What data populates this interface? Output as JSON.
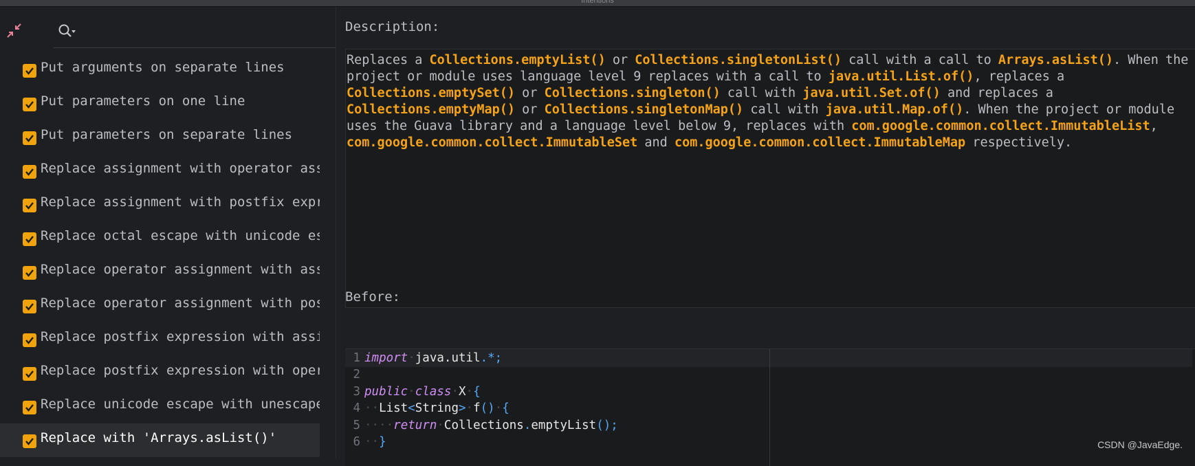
{
  "window": {
    "title": "Intentions"
  },
  "toolbar": {
    "collapse_icon": "collapse-icon",
    "search_icon": "search-icon"
  },
  "intentions": [
    {
      "label": "Put arguments on separate lines",
      "checked": true
    },
    {
      "label": "Put parameters on one line",
      "checked": true
    },
    {
      "label": "Put parameters on separate lines",
      "checked": true
    },
    {
      "label": "Replace assignment with operator assi",
      "checked": true
    },
    {
      "label": "Replace assignment with postfix expre",
      "checked": true
    },
    {
      "label": "Replace octal escape with unicode esc",
      "checked": true
    },
    {
      "label": "Replace operator assignment with assi",
      "checked": true
    },
    {
      "label": "Replace operator assignment with post",
      "checked": true
    },
    {
      "label": "Replace postfix expression with assig",
      "checked": true
    },
    {
      "label": "Replace postfix expression with opera",
      "checked": true
    },
    {
      "label": "Replace unicode escape with unescaped",
      "checked": true
    },
    {
      "label": "Replace with 'Arrays.asList()'",
      "checked": true,
      "selected": true
    }
  ],
  "description": {
    "title": "Description:",
    "segments": [
      {
        "t": "Replaces a ",
        "h": false
      },
      {
        "t": "Collections.emptyList()",
        "h": true
      },
      {
        "t": " or ",
        "h": false
      },
      {
        "t": "Collections.singletonList()",
        "h": true
      },
      {
        "t": " call with a call to ",
        "h": false
      },
      {
        "t": "Arrays.asList()",
        "h": true
      },
      {
        "t": ". When the project or module uses language level 9 replaces with a call to ",
        "h": false
      },
      {
        "t": "java.util.List.of()",
        "h": true
      },
      {
        "t": ", replaces a ",
        "h": false
      },
      {
        "t": "Collections.emptySet()",
        "h": true
      },
      {
        "t": " or ",
        "h": false
      },
      {
        "t": "Collections.singleton()",
        "h": true
      },
      {
        "t": " call with ",
        "h": false
      },
      {
        "t": "java.util.Set.of()",
        "h": true
      },
      {
        "t": " and replaces a ",
        "h": false
      },
      {
        "t": "Collections.emptyMap()",
        "h": true
      },
      {
        "t": " or ",
        "h": false
      },
      {
        "t": "Collections.singletonMap()",
        "h": true
      },
      {
        "t": " call with ",
        "h": false
      },
      {
        "t": "java.util.Map.of()",
        "h": true
      },
      {
        "t": ". When the project or module uses the Guava library and a language level below 9, replaces with ",
        "h": false
      },
      {
        "t": "com.google.common.collect.ImmutableList",
        "h": true
      },
      {
        "t": ", ",
        "h": false
      },
      {
        "t": "com.google.common.collect.ImmutableSet",
        "h": true
      },
      {
        "t": " and ",
        "h": false
      },
      {
        "t": "com.google.common.collect.ImmutableMap",
        "h": true
      },
      {
        "t": " respectively.",
        "h": false
      }
    ]
  },
  "before": {
    "title": "Before:",
    "lines": [
      {
        "n": "1",
        "tokens": [
          {
            "c": "kw",
            "t": "import"
          },
          {
            "c": "ws",
            "t": "·"
          },
          {
            "c": "id",
            "t": "java.util"
          },
          {
            "c": "pn",
            "t": ".*;"
          }
        ]
      },
      {
        "n": "2",
        "tokens": []
      },
      {
        "n": "3",
        "tokens": [
          {
            "c": "kw",
            "t": "public"
          },
          {
            "c": "ws",
            "t": "·"
          },
          {
            "c": "kw",
            "t": "class"
          },
          {
            "c": "ws",
            "t": "·"
          },
          {
            "c": "id",
            "t": "X"
          },
          {
            "c": "ws",
            "t": "·"
          },
          {
            "c": "pn",
            "t": "{"
          }
        ]
      },
      {
        "n": "4",
        "tokens": [
          {
            "c": "ws",
            "t": "··"
          },
          {
            "c": "id",
            "t": "List"
          },
          {
            "c": "pn",
            "t": "<"
          },
          {
            "c": "id",
            "t": "String"
          },
          {
            "c": "pn",
            "t": ">"
          },
          {
            "c": "ws",
            "t": "·"
          },
          {
            "c": "id",
            "t": "f"
          },
          {
            "c": "pn",
            "t": "()"
          },
          {
            "c": "ws",
            "t": "·"
          },
          {
            "c": "pn",
            "t": "{"
          }
        ]
      },
      {
        "n": "5",
        "tokens": [
          {
            "c": "ws",
            "t": "····"
          },
          {
            "c": "kw",
            "t": "return"
          },
          {
            "c": "ws",
            "t": "·"
          },
          {
            "c": "id",
            "t": "Collections"
          },
          {
            "c": "pn",
            "t": "."
          },
          {
            "c": "id",
            "t": "emptyList"
          },
          {
            "c": "pn",
            "t": "();"
          }
        ]
      },
      {
        "n": "6",
        "tokens": [
          {
            "c": "ws",
            "t": "··"
          },
          {
            "c": "pn",
            "t": "}"
          }
        ]
      }
    ]
  },
  "watermark": "CSDN @JavaEdge."
}
